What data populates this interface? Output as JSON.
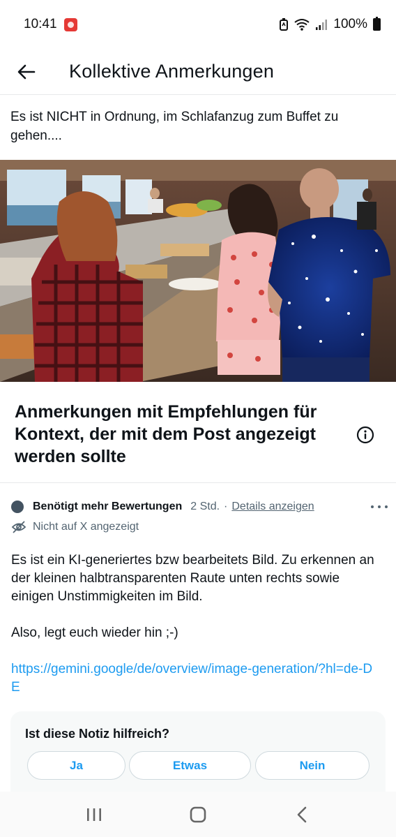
{
  "status_bar": {
    "time": "10:41",
    "battery": "100%",
    "icons": [
      "app-notification-icon",
      "battery-saver-icon",
      "wifi-icon",
      "signal-icon",
      "battery-icon"
    ]
  },
  "header": {
    "title": "Kollektive Anmerkungen",
    "back_icon": "arrow-left-icon"
  },
  "post": {
    "text": "Es ist NICHT in Ordnung, im Schlafanzug zum Buffet zu gehen....",
    "image_description_icon": "photo"
  },
  "section": {
    "title": "Anmerkungen mit Empfehlungen für Kontext, der mit dem Post angezeigt werden sollte",
    "info_icon": "info-icon"
  },
  "note": {
    "status": "Benötigt mehr Bewertungen",
    "time": "2 Std.",
    "separator": "·",
    "details_label": "Details anzeigen",
    "not_shown": "Nicht auf X angezeigt",
    "paragraph1": "Es ist ein KI-generiertes bzw bearbeitets Bild. Zu erkennen an der kleinen halbtransparenten Raute unten rechts sowie einigen Unstimmigkeiten im Bild.",
    "paragraph2": "Also, legt euch wieder hin ;-)",
    "link": "https://gemini.google/de/overview/image-generation/?hl=de-DE"
  },
  "rating": {
    "question": "Ist diese Notiz hilfreich?",
    "options": [
      "Ja",
      "Etwas",
      "Nein"
    ]
  },
  "colors": {
    "accent": "#1d9bf0",
    "text": "#0f1419",
    "secondary": "#536471",
    "card_bg": "#f7f9f9"
  }
}
